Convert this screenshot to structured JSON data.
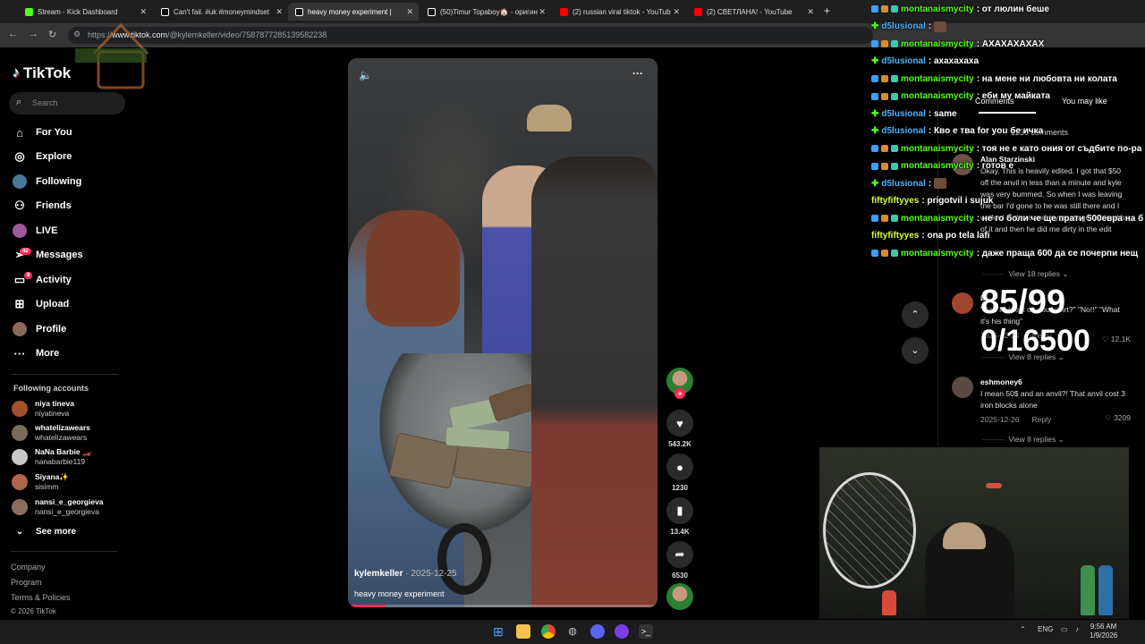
{
  "browser": {
    "tabs": [
      {
        "title": "Stream - Kick Dashboard",
        "color": "#53fc18"
      },
      {
        "title": "Can't fail. #uk #moneymindset",
        "color": "#ffffff"
      },
      {
        "title": "heavy money experiment |",
        "color": "#ffffff",
        "active": true
      },
      {
        "title": "(50)Timur Topaboy🏠 - оригин",
        "color": "#ffffff"
      },
      {
        "title": "(2) russian viral tiktok - YouTub",
        "color": "#ff0000"
      },
      {
        "title": "(2) СВЕТЛАНА! - YouTube",
        "color": "#ff0000"
      }
    ],
    "new_tab": "+",
    "url_scheme": "https://",
    "url_host": "www.tiktok.com",
    "url_path": "/@kylemkeller/video/7587877285139582238"
  },
  "sidebar": {
    "logo": "TikTok",
    "search_placeholder": "Search",
    "menu": [
      {
        "label": "For You",
        "icon": "home-icon"
      },
      {
        "label": "Explore",
        "icon": "compass-icon"
      },
      {
        "label": "Following",
        "icon": "following-icon"
      },
      {
        "label": "Friends",
        "icon": "friends-icon"
      },
      {
        "label": "LIVE",
        "icon": "live-icon"
      },
      {
        "label": "Messages",
        "icon": "messages-icon",
        "badge": "42"
      },
      {
        "label": "Activity",
        "icon": "activity-icon",
        "badge": "8"
      },
      {
        "label": "Upload",
        "icon": "upload-icon"
      },
      {
        "label": "Profile",
        "icon": "profile-icon"
      },
      {
        "label": "More",
        "icon": "more-icon"
      }
    ],
    "following_title": "Following accounts",
    "accounts": [
      {
        "name": "niya tineva",
        "handle": "niyatineva",
        "color": "#a0522d"
      },
      {
        "name": "whatelizawears",
        "handle": "whatelizawears",
        "color": "#7b6b5a"
      },
      {
        "name": "NaNa Barbie 🏎️",
        "handle": "nanabarbie119",
        "color": "#c8c8c8"
      },
      {
        "name": "Siyana✨",
        "handle": "sisimm",
        "color": "#b0654a"
      },
      {
        "name": "nansi_e_georgieva",
        "handle": "nansi_e_georgieva",
        "color": "#8a6d5e"
      }
    ],
    "see_more": "See more",
    "footer": [
      "Company",
      "Program",
      "Terms & Policies",
      "© 2026 TikTok"
    ]
  },
  "video": {
    "author": "kylemkeller",
    "date": " · 2025-12-25",
    "caption": "heavy money experiment",
    "progress": 0.12
  },
  "actions": {
    "likes": "543.2K",
    "comments": "1230",
    "saves": "13.4K",
    "shares": "6530"
  },
  "comments_panel": {
    "tab_comments": "Comments",
    "tab_like": "You may like",
    "count": "1230 comments",
    "items": [
      {
        "author": "Alan Starzinski",
        "text": "Okay. This is heavily edited. I got that $50 off the anvil in less than a minute and kyle was very bummed. So when I was leaving the bar I'd gone to he was still there and I walked in there and my pants got stained bc of it and then he did me dirty in the edit",
        "date": "",
        "reply": "",
        "likes": ""
      },
      {
        "author": "E...",
        "text": "\"Can I wipe it on your shirt?\" \"No!!\" \"What it's his thing\"",
        "date": "2025-12-25",
        "reply": "Reply",
        "likes": "12.1K"
      },
      {
        "author": "eshmoney6",
        "text": "I mean 50$ and an anvil?! That anvil cost 3 iron blocks alone",
        "date": "2025-12-26",
        "reply": "Reply",
        "likes": "3209"
      }
    ],
    "replies": [
      "View 18 replies",
      "View 8 replies",
      "View 8 replies"
    ]
  },
  "chat": [
    {
      "user": "montanaismycity",
      "msg": ": от люлин беше",
      "color": "#53fc18"
    },
    {
      "user": "d5lusional",
      "msg": ":",
      "color": "#53fc18"
    },
    {
      "user": "montanaismycity",
      "msg": ": АХАХАХАХАХ",
      "color": "#53fc18"
    },
    {
      "user": "d5lusional",
      "msg": ": ахахахаха",
      "color": "#53fc18"
    },
    {
      "user": "montanaismycity",
      "msg": ": на мене ни любовта ни колата",
      "color": "#53fc18"
    },
    {
      "user": "montanaismycity",
      "msg": ": еби му майката",
      "color": "#53fc18"
    },
    {
      "user": "d5lusional",
      "msg": ": same",
      "color": "#53fc18"
    },
    {
      "user": "d5lusional",
      "msg": ": Кво е тва for you бе ичка",
      "color": "#53fc18"
    },
    {
      "user": "montanaismycity",
      "msg": ": тоя не е като ония от съдбите по-ра",
      "color": "#53fc18"
    },
    {
      "user": "montanaismycity",
      "msg": ": готов е",
      "color": "#53fc18"
    },
    {
      "user": "d5lusional",
      "msg": ":",
      "color": "#53fc18"
    },
    {
      "user": "fiftyfiftyyes",
      "msg": ": prigotvil i sujuk",
      "color": "#53fc18"
    },
    {
      "user": "montanaismycity",
      "msg": ": не го боли че ще прати 500евра на б",
      "color": "#53fc18"
    },
    {
      "user": "fiftyfiftyyes",
      "msg": ": ona po tela lafi",
      "color": "#53fc18"
    },
    {
      "user": "montanaismycity",
      "msg": ": даже праща 600 да се почерпи нещ",
      "color": "#53fc18"
    }
  ],
  "counter": {
    "line1": "85/99",
    "line2": "0/16500"
  },
  "taskbar": {
    "lang": "ENG",
    "time": "9:56 AM",
    "date": "1/9/2026"
  }
}
